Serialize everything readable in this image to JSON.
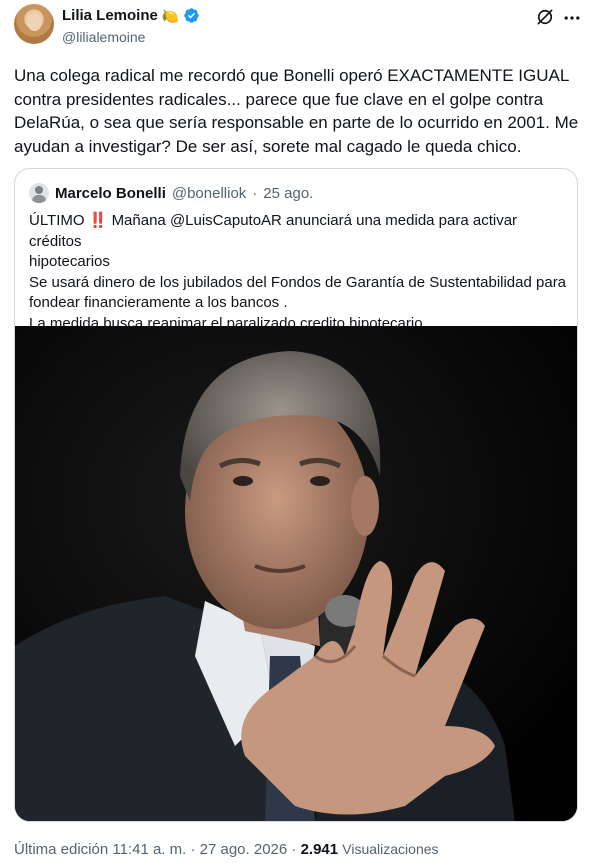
{
  "author": {
    "name": "Lilia Lemoine",
    "emoji": "🍋",
    "handle": "@lilialemoine"
  },
  "tweet": {
    "text": "Una colega radical me recordó que Bonelli operó EXACTAMENTE IGUAL\ncontra presidentes radicales... parece que fue clave en el golpe contra\nDelaRúa, o sea que sería responsable en parte de lo ocurrido en 2001. Me\nayudan a investigar? De ser así, sorete mal cagado le queda chico."
  },
  "quoted": {
    "name": "Marcelo Bonelli",
    "handle": "@bonelliok",
    "separator": "·",
    "date": "25 ago.",
    "text": "ÚLTIMO ‼️ Mañana @LuisCaputoAR anunciará una medida para activar créditos\nhipotecarios\nSe usará dinero de los jubilados del Fondos de Garantía de Sustentabilidad  para\nfondear financieramente a los bancos .\nLa medida busca reanimar el paralizado credito  hipotecario ."
  },
  "footer": {
    "edited": "Última edición 11:41 a. m. · 27 ago. 2026 ·",
    "views_count": "2.941",
    "views_label": "Visualizaciones"
  },
  "colors": {
    "verified": "#1d9bf0",
    "secondary_text": "#536471",
    "border": "#cfd9de"
  }
}
